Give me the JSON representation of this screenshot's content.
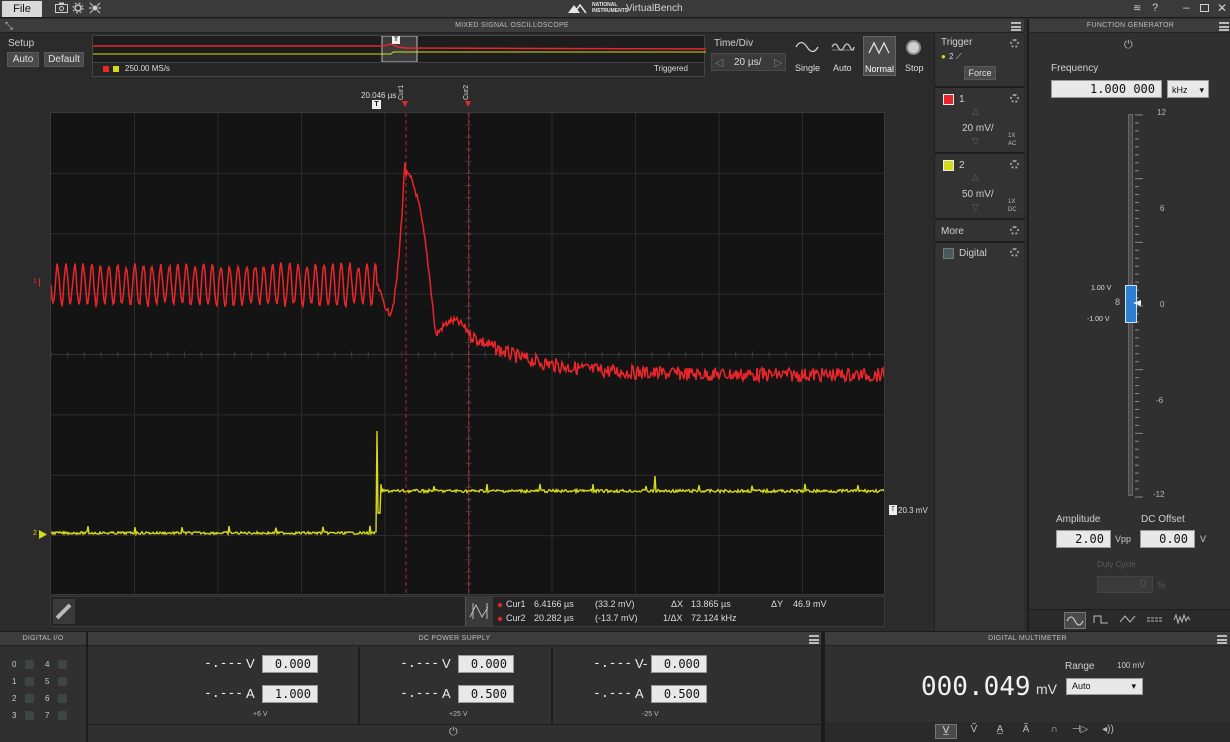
{
  "app": {
    "title": "VirtualBench",
    "brand": "NATIONAL INSTRUMENTS",
    "file_menu": "File"
  },
  "scope": {
    "header": "MIXED SIGNAL OSCILLOSCOPE",
    "setup_label": "Setup",
    "auto_label": "Auto",
    "default_label": "Default",
    "sample_rate": "250.00 MS/s",
    "status": "Triggered",
    "timediv_label": "Time/Div",
    "timediv_value": "20 µs/",
    "modes": [
      "Single",
      "Auto",
      "Normal",
      "Stop"
    ],
    "trigger_time": "20.046 µs",
    "cursor1_tag": "Cur1",
    "cursor2_tag": "Cur2",
    "trigger_level": "20.3 mV",
    "cursor_readout": {
      "cur1_label": "Cur1",
      "cur1_time": "6.4166 µs",
      "cur1_val": "(33.2 mV)",
      "cur2_label": "Cur2",
      "cur2_time": "20.282 µs",
      "cur2_val": "(-13.7 mV)",
      "dx_label": "ΔX",
      "dx": "13.865 µs",
      "inv_dx_label": "1/ΔX",
      "inv_dx": "72.124 kHz",
      "dy_label": "ΔY",
      "dy": "46.9 mV"
    }
  },
  "side": {
    "trigger_label": "Trigger",
    "trigger_source": "2",
    "force_label": "Force",
    "ch1": {
      "name": "1",
      "scale": "20 mV/",
      "probe": "1X",
      "coupling": "AC",
      "color": "#e8262b"
    },
    "ch2": {
      "name": "2",
      "scale": "50 mV/",
      "probe": "1X",
      "coupling": "DC",
      "color": "#d6d91c"
    },
    "more_label": "More",
    "digital_label": "Digital"
  },
  "fgen": {
    "header": "FUNCTION GENERATOR",
    "frequency_label": "Frequency",
    "frequency_value": "1.000 000",
    "frequency_unit": "kHz",
    "scale_ticks": [
      "12",
      "6",
      "0",
      "-6",
      "-12"
    ],
    "upper_level": "1.00 V",
    "lower_level": "-1.00 V",
    "amplitude_label": "Amplitude",
    "amplitude_value": "2.00",
    "amplitude_unit": "Vpp",
    "offset_label": "DC Offset",
    "offset_value": "0.00",
    "offset_unit": "V",
    "duty_label": "Duty Cycle",
    "duty_value": "0",
    "duty_unit": "%"
  },
  "dio": {
    "header": "DIGITAL I/O",
    "pins": [
      "0",
      "4",
      "1",
      "5",
      "2",
      "6",
      "3",
      "7"
    ]
  },
  "psu": {
    "header": "DC POWER SUPPLY",
    "channels": [
      {
        "v_read": "-.---",
        "v_unit": "V",
        "v_set": "0.000",
        "a_read": "-.---",
        "a_unit": "A",
        "a_set": "1.000",
        "name": "+6 V"
      },
      {
        "v_read": "-.---",
        "v_unit": "V",
        "v_set": "0.000",
        "a_read": "-.---",
        "a_unit": "A",
        "a_set": "0.500",
        "name": "+25 V"
      },
      {
        "v_read": "-.---",
        "v_unit": "V-",
        "v_set": "0.000",
        "a_read": "-.---",
        "a_unit": "A",
        "a_set": "0.500",
        "name": "-25 V"
      }
    ]
  },
  "dmm": {
    "header": "DIGITAL MULTIMETER",
    "reading": "000.049",
    "unit": "mV",
    "range_label": "Range",
    "range_value": "100 mV",
    "range_select": "Auto"
  }
}
